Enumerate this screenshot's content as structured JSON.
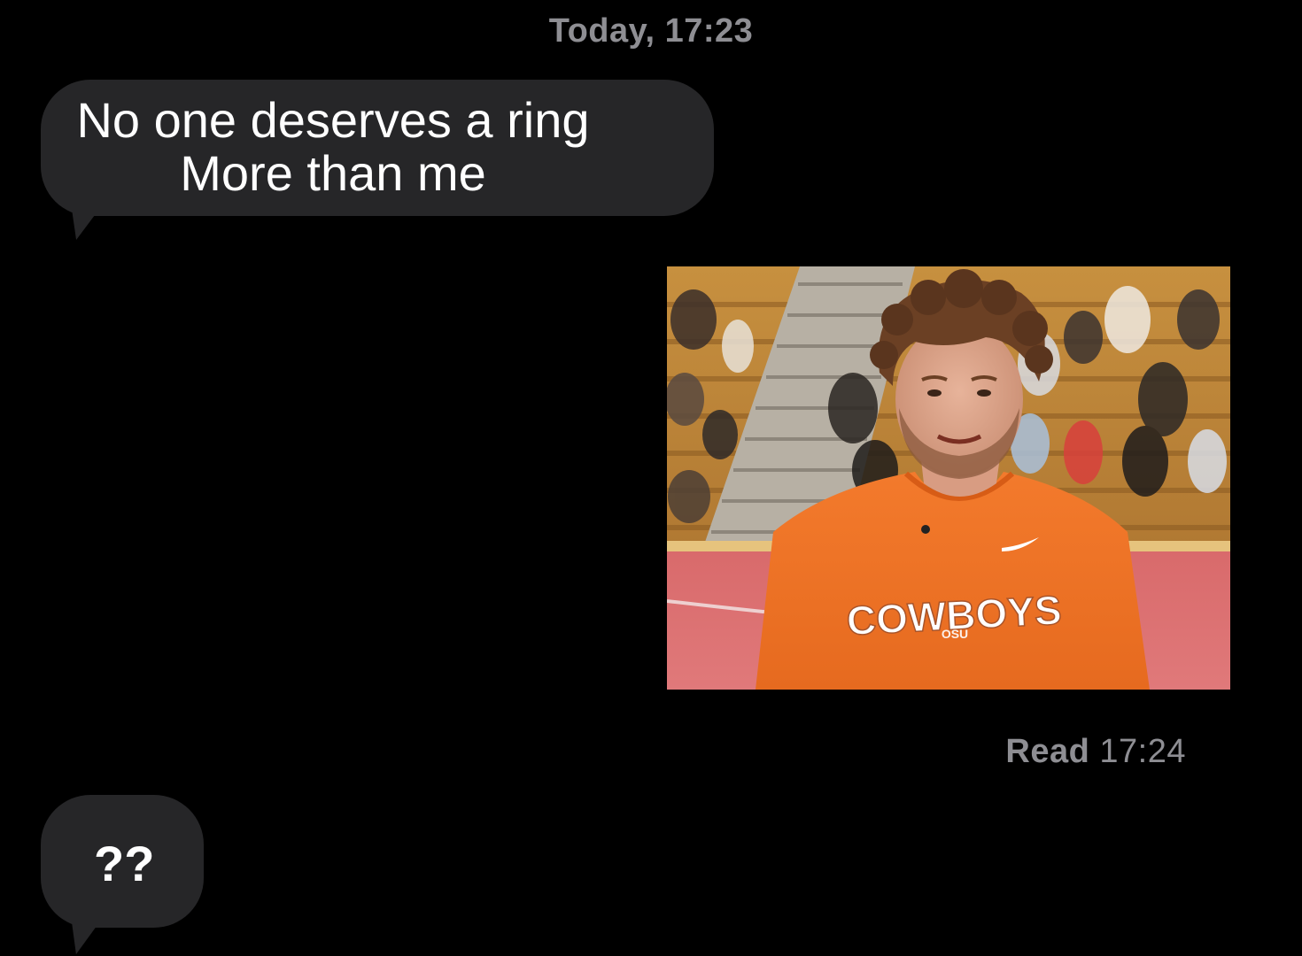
{
  "header": {
    "timestamp": "Today, 17:23"
  },
  "messages": [
    {
      "direction": "incoming",
      "lines": [
        "No one deserves a ring",
        "More than me"
      ]
    },
    {
      "direction": "outgoing",
      "type": "image",
      "shirt_text": "COWBOYS",
      "shirt_subtext": "OSU"
    },
    {
      "direction": "incoming",
      "text": "??"
    }
  ],
  "read_receipt": {
    "label": "Read",
    "time": "17:24"
  },
  "colors": {
    "background": "#000000",
    "incoming_bubble": "#262628",
    "meta_text": "#8e8e93",
    "message_text": "#ffffff"
  }
}
